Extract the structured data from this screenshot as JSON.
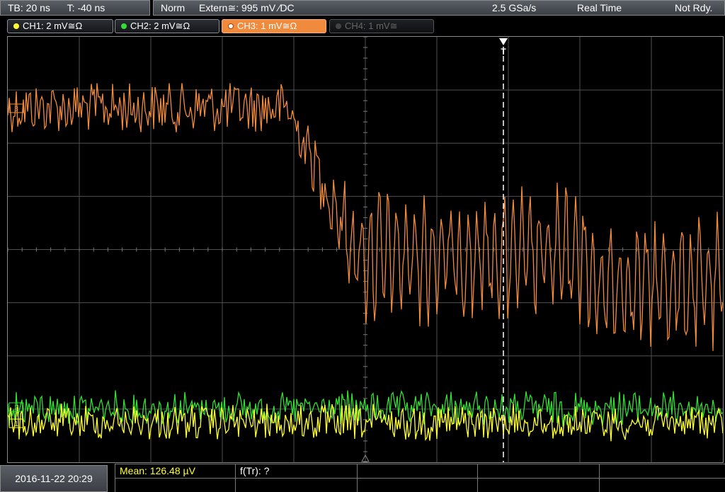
{
  "header": {
    "timebase": "TB: 20 ns",
    "trigger_time": "T: -40 ns",
    "mode": "Norm",
    "trigger_source": "Extern≅: 995 mV ∕DC",
    "sample_rate": "2.5 GSa/s",
    "acq_mode": "Real Time",
    "status": "Not Rdy."
  },
  "channels": [
    {
      "label": "CH1: 2 mV≅Ω",
      "color": "#ffff33",
      "state": "on"
    },
    {
      "label": "CH2: 2 mV≅Ω",
      "color": "#33dd33",
      "state": "on"
    },
    {
      "label": "CH3: 1 mV≅Ω",
      "color": "#f08a3c",
      "state": "active"
    },
    {
      "label": "CH4: 1 mV≅",
      "color": "#666666",
      "state": "off"
    }
  ],
  "screen": {
    "trigger_marker": "T",
    "ch3_marker": "3",
    "ch1_marker": "1",
    "ch2_marker": "2"
  },
  "footer": {
    "datetime": "2016-11-22 20:29",
    "mean_label": "Mean: 126.48 µV",
    "rise_label": "f(Tr): ?"
  },
  "colors": {
    "ch1": "#ffff33",
    "ch2": "#33dd33",
    "ch3": "#f08a3c",
    "grid": "#505050",
    "trigger_line": "#ffffff"
  }
}
